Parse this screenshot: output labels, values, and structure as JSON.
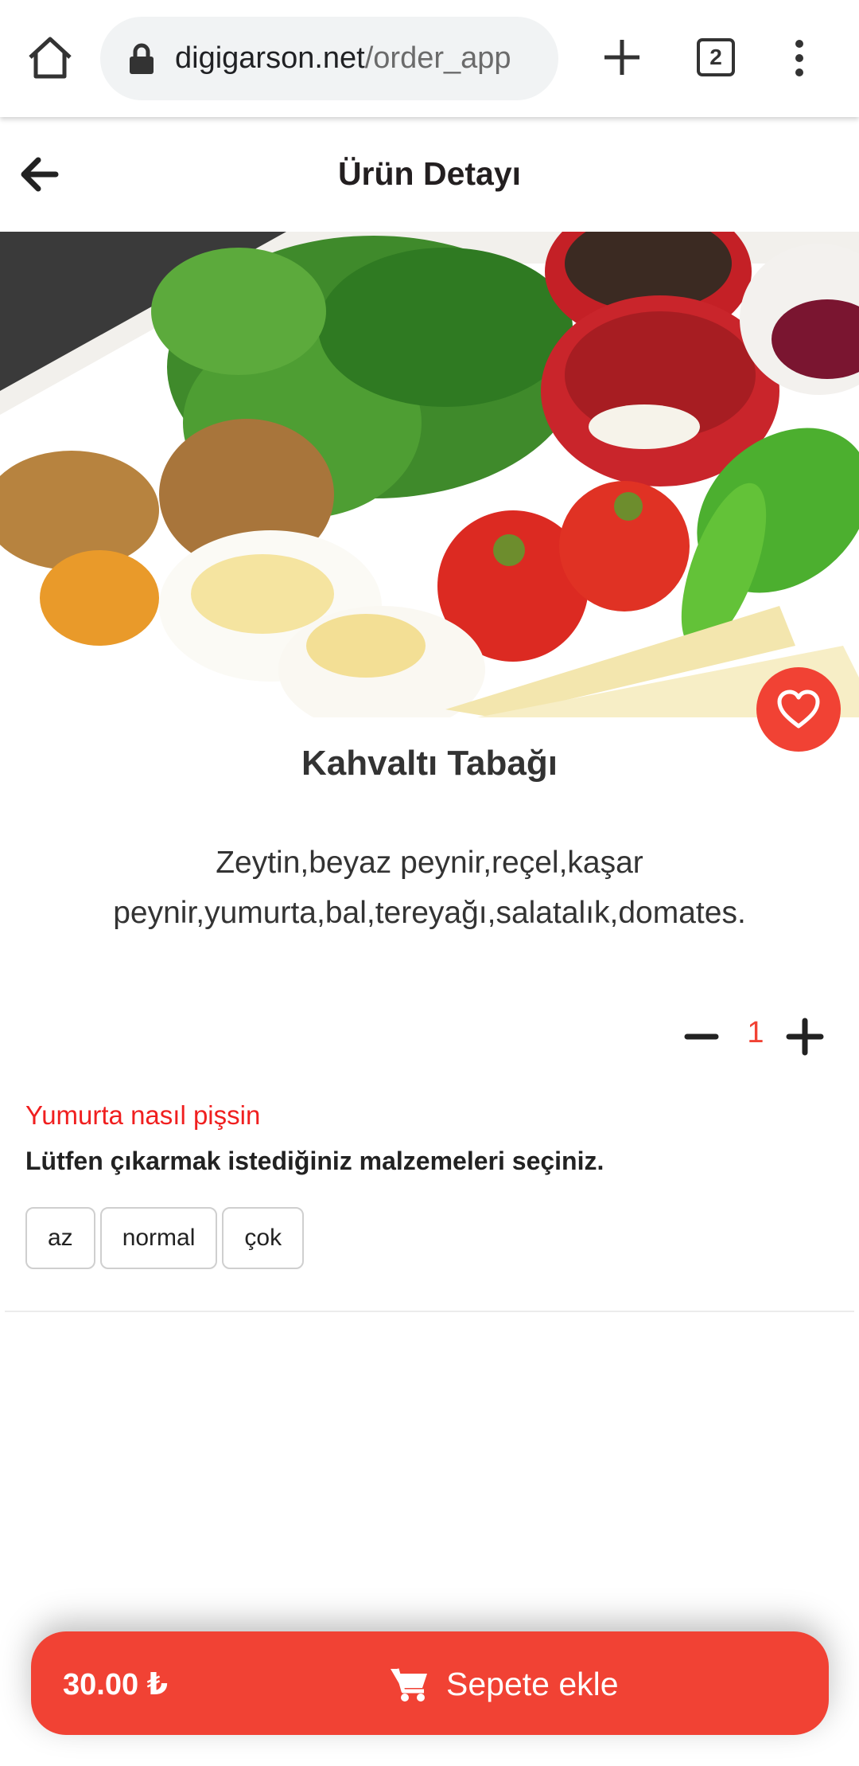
{
  "browser": {
    "url_host": "digigarson.net",
    "url_path": "/order_app",
    "tab_count": "2"
  },
  "header": {
    "title": "Ürün Detayı"
  },
  "product": {
    "name": "Kahvaltı Tabağı",
    "description": "Zeytin,beyaz peynir,reçel,kaşar peynir,yumurta,bal,tereyağı,salatalık,domates.",
    "quantity": "1"
  },
  "options": {
    "title": "Yumurta nasıl pişsin",
    "subtitle": "Lütfen çıkarmak istediğiniz malzemeleri seçiniz.",
    "choices": [
      "az",
      "normal",
      "çok"
    ]
  },
  "cart": {
    "price": "30.00 ₺",
    "add_label": "Sepete ekle"
  },
  "icons": {
    "home": "home-icon",
    "lock": "lock-icon",
    "new_tab": "plus-icon",
    "tabs": "tab-switcher-icon",
    "menu": "more-vert-icon",
    "back": "arrow-left-icon",
    "favorite": "heart-icon",
    "minus": "minus-icon",
    "plus": "plus-icon",
    "cart": "cart-icon"
  },
  "colors": {
    "accent": "#f14234",
    "option_title": "#f01f1f",
    "text": "#222222"
  }
}
